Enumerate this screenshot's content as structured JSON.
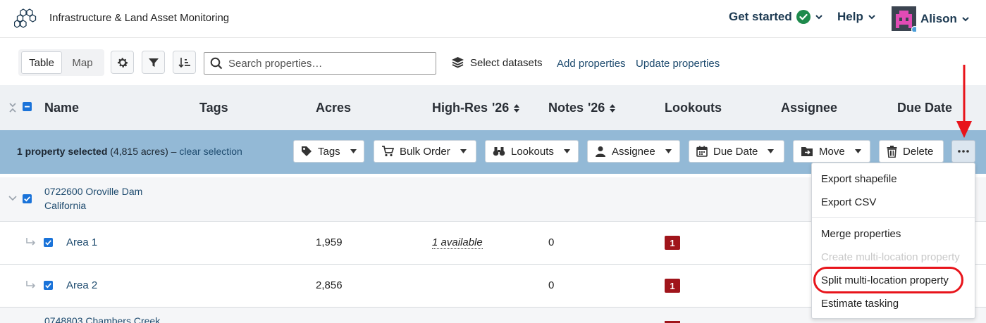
{
  "header": {
    "app_title": "Infrastructure & Land Asset Monitoring",
    "get_started": "Get started",
    "help": "Help",
    "user": "Alison"
  },
  "toolbar": {
    "view_table": "Table",
    "view_map": "Map",
    "search_placeholder": "Search properties…",
    "select_datasets": "Select datasets",
    "add_properties": "Add properties",
    "update_properties": "Update properties"
  },
  "columns": {
    "name": "Name",
    "tags": "Tags",
    "acres": "Acres",
    "highres": "High-Res",
    "highres_year": "'26",
    "notes": "Notes",
    "notes_year": "'26",
    "lookouts": "Lookouts",
    "assignee": "Assignee",
    "due_date": "Due Date"
  },
  "selection": {
    "count_text": "1 property selected",
    "acres_text": "(4,815 acres) –",
    "clear": "clear selection",
    "actions": {
      "tags": "Tags",
      "bulk_order": "Bulk Order",
      "lookouts": "Lookouts",
      "assignee": "Assignee",
      "due_date": "Due Date",
      "move": "Move",
      "delete": "Delete"
    }
  },
  "rows": {
    "group1_line1": "0722600 Oroville Dam",
    "group1_line2": "California",
    "area1": {
      "name": "Area 1",
      "acres": "1,959",
      "highres": "1 available",
      "notes": "0",
      "lookouts": "1"
    },
    "area2": {
      "name": "Area 2",
      "acres": "2,856",
      "notes": "0",
      "lookouts": "1"
    },
    "group2_line1": "0748803 Chambers Creek"
  },
  "menu": {
    "export_shapefile": "Export shapefile",
    "export_csv": "Export CSV",
    "merge": "Merge properties",
    "create_multi": "Create multi-location property",
    "split_multi": "Split multi-location property",
    "estimate": "Estimate tasking"
  },
  "colors": {
    "accent": "#1d4a6e",
    "selection_bar": "#93b9d6",
    "badge": "#a0151b",
    "annotation": "#e8141b",
    "check_green": "#1e8a4c"
  }
}
